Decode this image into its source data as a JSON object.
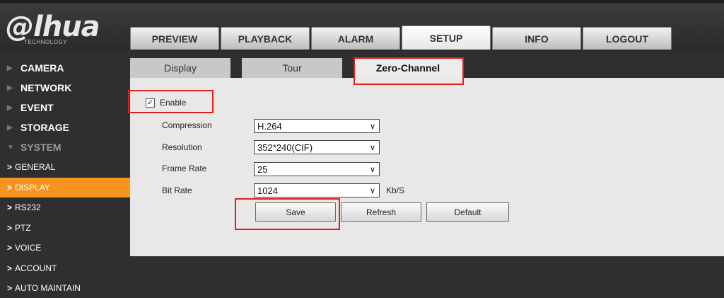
{
  "brand": {
    "logo": "alhua",
    "tagline": "TECHNOLOGY"
  },
  "topnav": [
    "PREVIEW",
    "PLAYBACK",
    "ALARM",
    "SETUP",
    "INFO",
    "LOGOUT"
  ],
  "sidebar": {
    "sections": [
      "CAMERA",
      "NETWORK",
      "EVENT",
      "STORAGE",
      "SYSTEM"
    ],
    "system_items": [
      "GENERAL",
      "DISPLAY",
      "RS232",
      "PTZ",
      "VOICE",
      "ACCOUNT",
      "AUTO MAINTAIN"
    ]
  },
  "subtabs": [
    "Display",
    "Tour",
    "Zero-Channel"
  ],
  "form": {
    "enable_label": "Enable",
    "enable_checked": true,
    "compression_label": "Compression",
    "compression_value": "H.264",
    "resolution_label": "Resolution",
    "resolution_value": "352*240(CIF)",
    "frame_rate_label": "Frame Rate",
    "frame_rate_value": "25",
    "bit_rate_label": "Bit Rate",
    "bit_rate_value": "1024",
    "bit_rate_unit": "Kb/S",
    "checkmark": "✓",
    "dropdown_glyph": "∨"
  },
  "buttons": {
    "save": "Save",
    "refresh": "Refresh",
    "default": "Default"
  },
  "colors": {
    "active_sidebar": "#f7941d",
    "highlight": "#e0201e"
  }
}
